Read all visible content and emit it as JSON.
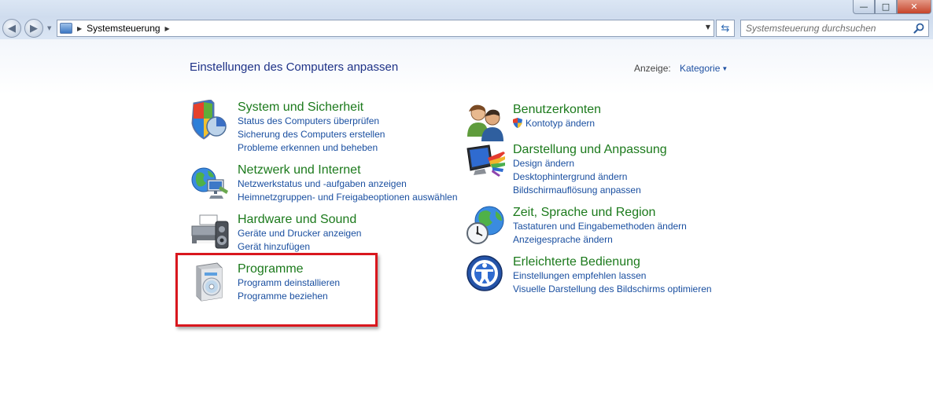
{
  "window": {
    "minimize_label": "—",
    "maximize_label": "□",
    "close_label": "✕",
    "icons": {
      "minimize": "minimize-icon",
      "maximize": "maximize-icon",
      "close": "close-icon"
    }
  },
  "navigation": {
    "back_icon": "back-arrow-icon",
    "forward_icon": "forward-arrow-icon",
    "breadcrumb": [
      "Systemsteuerung"
    ],
    "search_placeholder": "Systemsteuerung durchsuchen"
  },
  "main": {
    "heading": "Einstellungen des Computers anpassen",
    "view_by_label": "Anzeige:",
    "view_mode": "Kategorie",
    "categories": [
      {
        "title": "System und Sicherheit",
        "icon": "shield-pie-icon",
        "links": [
          "Status des Computers überprüfen",
          "Sicherung des Computers erstellen",
          "Probleme erkennen und beheben"
        ]
      },
      {
        "title": "Netzwerk und Internet",
        "icon": "globe-network-icon",
        "links": [
          "Netzwerkstatus und -aufgaben anzeigen",
          "Heimnetzgruppen- und Freigabeoptionen auswählen"
        ]
      },
      {
        "title": "Hardware und Sound",
        "icon": "printer-speaker-icon",
        "links": [
          "Geräte und Drucker anzeigen",
          "Gerät hinzufügen"
        ]
      },
      {
        "title": "Programme",
        "icon": "software-box-icon",
        "links": [
          "Programm deinstallieren",
          "Programme beziehen"
        ]
      },
      {
        "title": "Benutzerkonten",
        "icon": "users-icon",
        "links": [
          "Kontotyp ändern"
        ]
      },
      {
        "title": "Darstellung und Anpassung",
        "icon": "monitor-palette-icon",
        "links": [
          "Design ändern",
          "Desktophintergrund ändern",
          "Bildschirmauflösung anpassen"
        ]
      },
      {
        "title": "Zeit, Sprache und Region",
        "icon": "globe-clock-icon",
        "links": [
          "Tastaturen und Eingabemethoden ändern",
          "Anzeigesprache ändern"
        ]
      },
      {
        "title": "Erleichterte Bedienung",
        "icon": "accessibility-icon",
        "links": [
          "Einstellungen empfehlen lassen",
          "Visuelle Darstellung des Bildschirms optimieren"
        ]
      }
    ]
  },
  "colors": {
    "category_title": "#1c7a1c",
    "link": "#1a4fa0",
    "heading": "#1e3287",
    "highlight_box": "#d9171e"
  }
}
